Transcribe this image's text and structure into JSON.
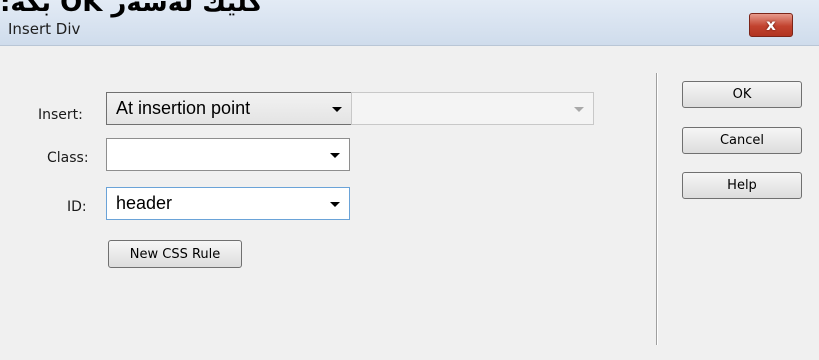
{
  "overlay_text": "كلیك لەسەر  OK بكە:",
  "window": {
    "title": "Insert Div",
    "close_glyph": "x"
  },
  "form": {
    "insert": {
      "label": "Insert:",
      "value": "At insertion point",
      "secondary_value": ""
    },
    "class": {
      "label": "Class:",
      "value": ""
    },
    "id": {
      "label": "ID:",
      "value": "header"
    },
    "new_css_rule_label": "New CSS Rule"
  },
  "buttons": {
    "ok": "OK",
    "cancel": "Cancel",
    "help": "Help"
  }
}
